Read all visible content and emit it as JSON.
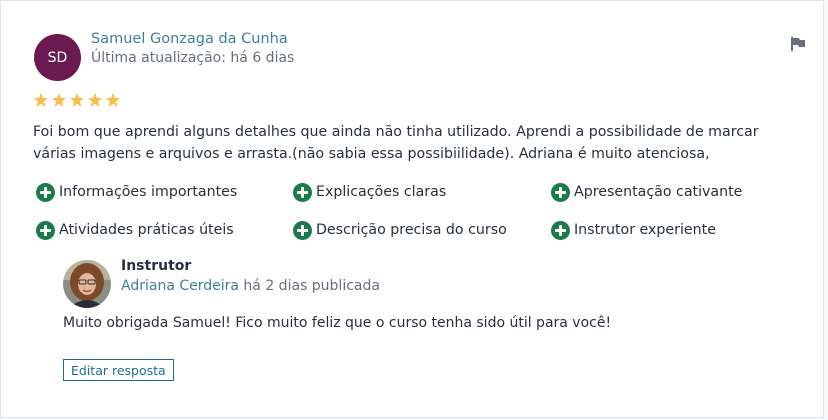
{
  "review": {
    "author_initials": "SD",
    "author_name": "Samuel Gonzaga da Cunha",
    "updated": "Última atualização: há 6 dias",
    "rating": 5,
    "text": "Foi bom que aprendi alguns detalhes que ainda não tinha utilizado. Aprendi a possibilidade de marcar várias imagens e arquivos e arrasta.(não sabia essa possibiilidade). Adriana é muito atenciosa,",
    "tags": [
      "Informações importantes",
      "Explicações claras",
      "Apresentação cativante",
      "Atividades práticas úteis",
      "Descrição precisa do curso",
      "Instrutor experiente"
    ]
  },
  "response": {
    "label": "Instrutor",
    "name": "Adriana Cerdeira",
    "time": "há 2 dias publicada",
    "text": "Muito obrigada Samuel! Fico muito feliz que o curso tenha sido útil para você!",
    "edit_label": "Editar resposta"
  },
  "colors": {
    "avatar_bg": "#6a1a4e",
    "link": "#3f7f95",
    "star": "#f4c150",
    "plus": "#1a7a4a"
  },
  "icons": {
    "flag": "flag-icon",
    "star": "star-icon",
    "tag": "plus-circle-icon"
  }
}
